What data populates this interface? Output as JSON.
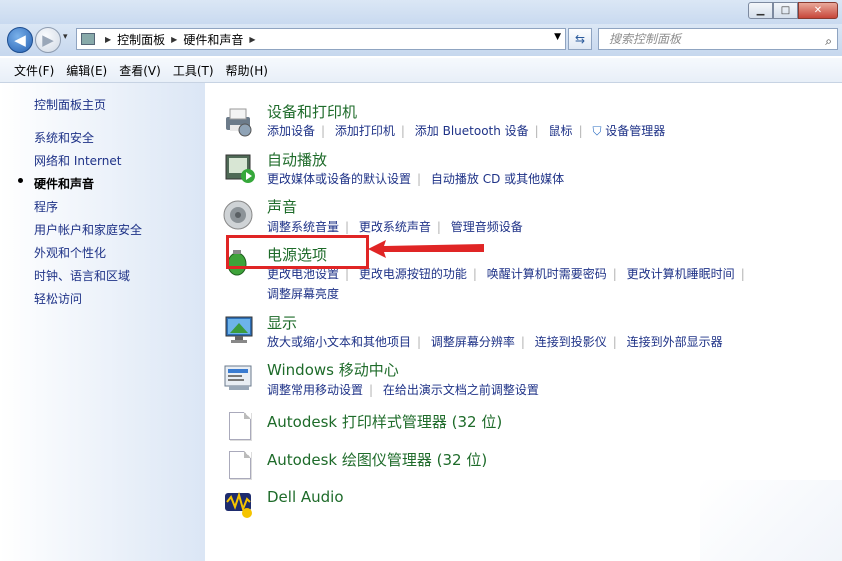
{
  "window": {
    "min_icon": "minimize-icon",
    "max_icon": "maximize-icon",
    "close_icon": "close-icon"
  },
  "nav": {
    "back_glyph": "◀",
    "forward_glyph": "▶",
    "breadcrumb": [
      "控制面板",
      "硬件和声音"
    ],
    "search_placeholder": "搜索控制面板"
  },
  "menu": [
    "文件(F)",
    "编辑(E)",
    "查看(V)",
    "工具(T)",
    "帮助(H)"
  ],
  "sidebar": {
    "home": "控制面板主页",
    "items": [
      "系统和安全",
      "网络和 Internet",
      "硬件和声音",
      "程序",
      "用户帐户和家庭安全",
      "外观和个性化",
      "时钟、语言和区域",
      "轻松访问"
    ],
    "current_index": 2
  },
  "categories": [
    {
      "title": "设备和打印机",
      "icon": "printer-icon",
      "links": [
        "添加设备",
        "添加打印机",
        "添加 Bluetooth 设备",
        "鼠标",
        "设备管理器"
      ]
    },
    {
      "title": "自动播放",
      "icon": "autoplay-icon",
      "links": [
        "更改媒体或设备的默认设置",
        "自动播放 CD 或其他媒体"
      ]
    },
    {
      "title": "声音",
      "icon": "speaker-icon",
      "links": [
        "调整系统音量",
        "更改系统声音",
        "管理音频设备"
      ]
    },
    {
      "title": "电源选项",
      "icon": "battery-icon",
      "links": [
        "更改电池设置",
        "更改电源按钮的功能",
        "唤醒计算机时需要密码",
        "更改计算机睡眠时间"
      ],
      "links2": [
        "调整屏幕亮度"
      ]
    },
    {
      "title": "显示",
      "icon": "display-icon",
      "links": [
        "放大或缩小文本和其他项目",
        "调整屏幕分辨率",
        "连接到投影仪",
        "连接到外部显示器"
      ]
    },
    {
      "title": "Windows 移动中心",
      "icon": "mobility-center-icon",
      "links": [
        "调整常用移动设置",
        "在给出演示文档之前调整设置"
      ]
    },
    {
      "title": "Autodesk 打印样式管理器 (32 位)",
      "icon": "document-icon",
      "links": []
    },
    {
      "title": "Autodesk 绘图仪管理器 (32 位)",
      "icon": "document-icon",
      "links": []
    },
    {
      "title": "Dell Audio",
      "icon": "dell-audio-icon",
      "links": []
    }
  ],
  "colors": {
    "category_title": "#1e6b2a",
    "link": "#1e3287",
    "highlight": "#e02525"
  }
}
